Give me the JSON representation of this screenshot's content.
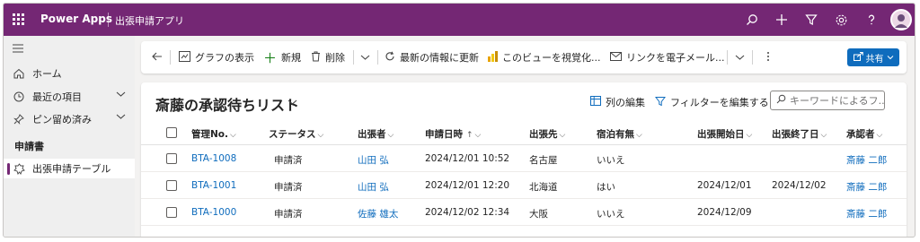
{
  "topbar": {
    "brand": "Power Apps",
    "app_name": "出張申請アプリ",
    "icons": [
      "search-icon",
      "plus-icon",
      "filter-icon",
      "settings-icon",
      "help-icon",
      "avatar"
    ]
  },
  "sidebar": {
    "items": [
      {
        "label": "ホーム",
        "icon": "home-icon"
      },
      {
        "label": "最近の項目",
        "icon": "clock-icon"
      },
      {
        "label": "ピン留め済み",
        "icon": "pin-icon"
      }
    ],
    "group_label": "申請書",
    "table_item": {
      "label": "出張申請テーブル",
      "icon": "table-icon"
    }
  },
  "commandbar": {
    "show_chart": "グラフの表示",
    "new": "新規",
    "delete": "削除",
    "refresh": "最新の情報に更新",
    "visualize": "このビューを視覚化...",
    "email_link": "リンクを電子メール...",
    "share": "共有"
  },
  "view": {
    "title": "斎藤の承認待ちリスト",
    "edit_columns": "列の編集",
    "edit_filters": "フィルターを編集する",
    "search_placeholder": "キーワードによるフ..."
  },
  "table": {
    "columns": [
      "管理No.",
      "ステータス",
      "出張者",
      "申請日時",
      "出張先",
      "宿泊有無",
      "出張開始日",
      "出張終了日",
      "承認者"
    ],
    "sort_indicator": "↑",
    "rows": [
      {
        "no": "BTA-1008",
        "status": "申請済",
        "traveler": "山田 弘",
        "applied": "2024/12/01 10:52",
        "dest": "名古屋",
        "stay": "いいえ",
        "start": "",
        "end": "",
        "approver": "斎藤 二郎"
      },
      {
        "no": "BTA-1001",
        "status": "申請済",
        "traveler": "山田 弘",
        "applied": "2024/12/01 12:20",
        "dest": "北海道",
        "stay": "はい",
        "start": "2024/12/01",
        "end": "2024/12/02",
        "approver": "斎藤 二郎"
      },
      {
        "no": "BTA-1000",
        "status": "申請済",
        "traveler": "佐藤 雄太",
        "applied": "2024/12/02 12:34",
        "dest": "大阪",
        "stay": "いいえ",
        "start": "2024/12/09",
        "end": "",
        "approver": "斎藤 二郎"
      }
    ]
  },
  "colors": {
    "brand_purple": "#742774",
    "link_blue": "#0f6cbd"
  }
}
